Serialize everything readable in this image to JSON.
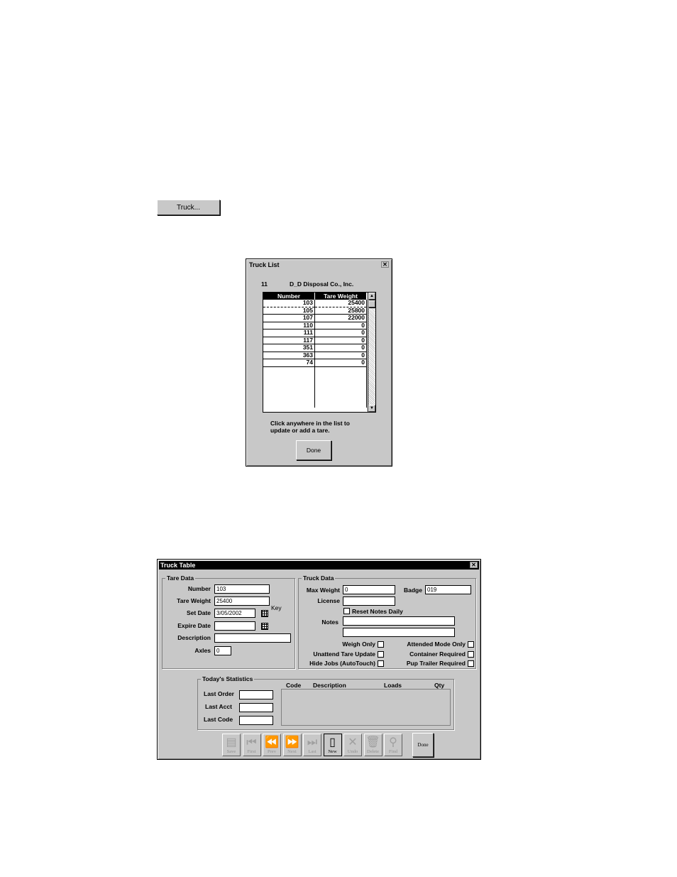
{
  "truck_button": {
    "label": "Truck..."
  },
  "truck_list": {
    "title": "Truck List",
    "customer_number": "11",
    "customer_name": "D_D Disposal Co., Inc.",
    "columns": [
      "Number",
      "Tare Weight"
    ],
    "rows": [
      {
        "number": "103",
        "tare": "25400"
      },
      {
        "number": "105",
        "tare": "25800"
      },
      {
        "number": "107",
        "tare": "22000"
      },
      {
        "number": "110",
        "tare": "0"
      },
      {
        "number": "111",
        "tare": "0"
      },
      {
        "number": "117",
        "tare": "0"
      },
      {
        "number": "351",
        "tare": "0"
      },
      {
        "number": "363",
        "tare": "0"
      },
      {
        "number": "74",
        "tare": "0"
      }
    ],
    "hint": "Click anywhere in the list to update or add a tare.",
    "done_label": "Done",
    "close_glyph": "✕"
  },
  "truck_table": {
    "title": "Truck Table",
    "close_glyph": "✕",
    "tare_data": {
      "group_label": "Tare Data",
      "number_label": "Number",
      "number_value": "103",
      "tare_weight_label": "Tare Weight",
      "tare_weight_value": "25400",
      "set_date_label": "Set Date",
      "set_date_value": "3/05/2002",
      "key_label": "Key",
      "expire_date_label": "Expire Date",
      "expire_date_value": "",
      "description_label": "Description",
      "description_value": "",
      "axles_label": "Axles",
      "axles_value": "0"
    },
    "truck_data": {
      "group_label": "Truck Data",
      "max_weight_label": "Max Weight",
      "max_weight_value": "0",
      "badge_label": "Badge",
      "badge_value": "019",
      "license_label": "License",
      "license_value": "",
      "reset_notes_label": "Reset Notes Daily",
      "notes_label": "Notes",
      "weigh_only_label": "Weigh Only",
      "attended_mode_label": "Attended Mode Only",
      "unattend_tare_label": "Unattend Tare Update",
      "container_required_label": "Container Required",
      "hide_jobs_label": "Hide Jobs (AutoTouch)",
      "pup_trailer_label": "Pup Trailer Required"
    },
    "stats": {
      "group_label": "Today's Statistics",
      "last_order_label": "Last Order",
      "last_acct_label": "Last Acct",
      "last_code_label": "Last Code",
      "columns": [
        "Code",
        "Description",
        "Loads",
        "Qty"
      ]
    },
    "toolbar": [
      {
        "label": "Save",
        "icon": "save-icon",
        "glyph": "▤"
      },
      {
        "label": "First",
        "icon": "first-icon",
        "glyph": "⏮"
      },
      {
        "label": "Prev",
        "icon": "prev-icon",
        "glyph": "⏪"
      },
      {
        "label": "Next",
        "icon": "next-icon",
        "glyph": "⏩"
      },
      {
        "label": "Last",
        "icon": "last-icon",
        "glyph": "⏭"
      },
      {
        "label": "New",
        "icon": "new-icon",
        "glyph": "▯"
      },
      {
        "label": "Undo",
        "icon": "undo-icon",
        "glyph": "✕"
      },
      {
        "label": "Delete",
        "icon": "delete-icon",
        "glyph": "🗑"
      },
      {
        "label": "Find",
        "icon": "find-icon",
        "glyph": "⚲"
      }
    ],
    "done_label": "Done"
  }
}
